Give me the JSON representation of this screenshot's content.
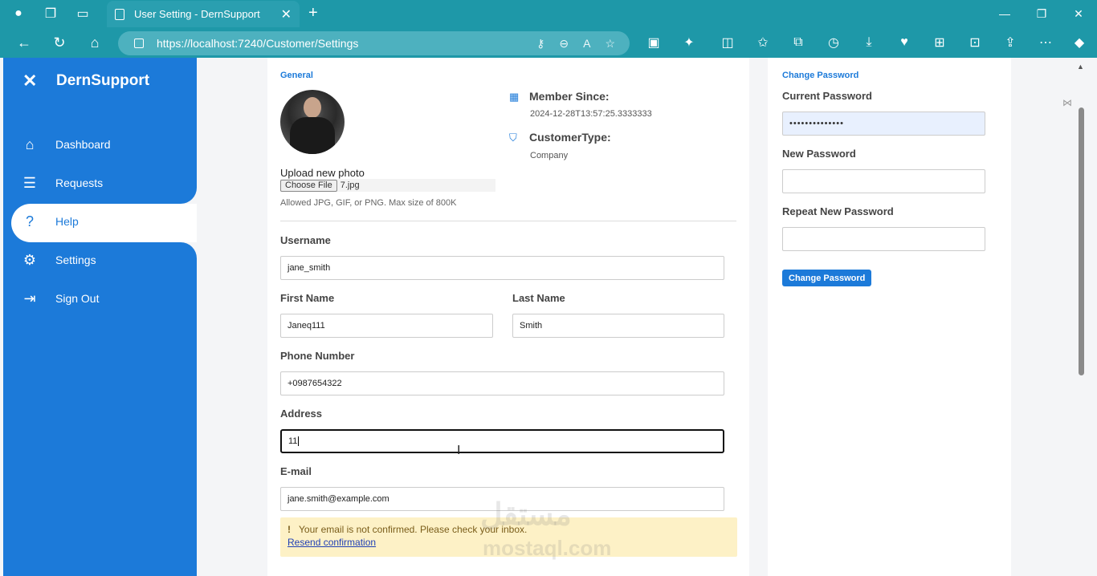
{
  "browser": {
    "tab_title": "User Setting - DernSupport",
    "url": "https://localhost:7240/Customer/Settings"
  },
  "sidebar": {
    "brand": "DernSupport",
    "items": [
      {
        "label": "Dashboard",
        "icon": "home-icon"
      },
      {
        "label": "Requests",
        "icon": "list-icon"
      },
      {
        "label": "Help",
        "icon": "question-icon",
        "active": true
      },
      {
        "label": "Settings",
        "icon": "gear-icon"
      },
      {
        "label": "Sign Out",
        "icon": "sign-out-icon"
      }
    ]
  },
  "general": {
    "section_label": "General",
    "upload_title": "Upload new photo",
    "choose_file": "Choose File",
    "file_name": "7.jpg",
    "hint": "Allowed JPG, GIF, or PNG. Max size of 800K",
    "member_since_label": "Member Since:",
    "member_since_value": "2024-12-28T13:57:25.3333333",
    "customer_type_label": "CustomerType:",
    "customer_type_value": "Company"
  },
  "form": {
    "username_label": "Username",
    "username_value": "jane_smith",
    "first_name_label": "First Name",
    "first_name_value": "Janeq111",
    "last_name_label": "Last Name",
    "last_name_value": "Smith",
    "phone_label": "Phone Number",
    "phone_value": "+0987654322",
    "address_label": "Address",
    "address_value": "11",
    "email_label": "E-mail",
    "email_value": "jane.smith@example.com"
  },
  "alert": {
    "bang": "!",
    "message": "Your email is not confirmed. Please check your inbox.",
    "link": "Resend confirmation"
  },
  "password": {
    "section_label": "Change Password",
    "current_label": "Current Password",
    "current_value": "••••••••••••••",
    "new_label": "New Password",
    "repeat_label": "Repeat New Password",
    "button": "Change Password"
  },
  "watermark": {
    "arabic": "مستقل",
    "latin": "mostaql.com"
  },
  "colors": {
    "accent": "#1c7ad9",
    "browser_chrome": "#1e98a8",
    "alert_bg": "#fdf1c6"
  }
}
